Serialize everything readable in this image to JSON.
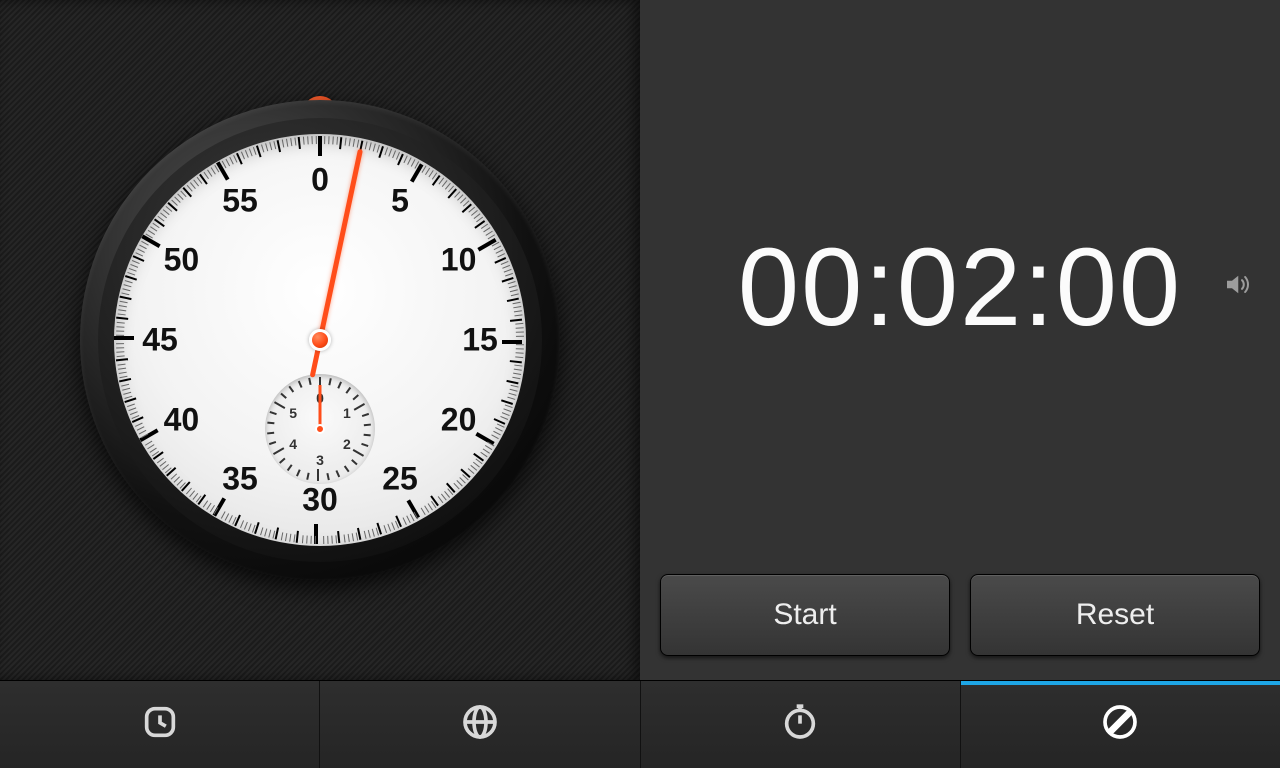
{
  "timer": {
    "display": "00:02:00",
    "start_label": "Start",
    "reset_label": "Reset",
    "sound_on": true
  },
  "dial": {
    "main_numbers": [
      "0",
      "5",
      "10",
      "15",
      "20",
      "25",
      "30",
      "35",
      "40",
      "45",
      "50",
      "55"
    ],
    "sub_numbers": [
      "0",
      "1",
      "2",
      "3",
      "4",
      "5"
    ],
    "main_hand_seconds": 2,
    "sub_hand_minutes": 0
  },
  "tabs": [
    {
      "id": "alarm",
      "icon": "alarm-clock-icon",
      "active": false
    },
    {
      "id": "world",
      "icon": "globe-icon",
      "active": false
    },
    {
      "id": "stopwatch",
      "icon": "stopwatch-icon",
      "active": false
    },
    {
      "id": "timer",
      "icon": "timer-icon",
      "active": true
    }
  ],
  "colors": {
    "accent": "#ff4d1a",
    "active_tab": "#1ea6e6"
  }
}
